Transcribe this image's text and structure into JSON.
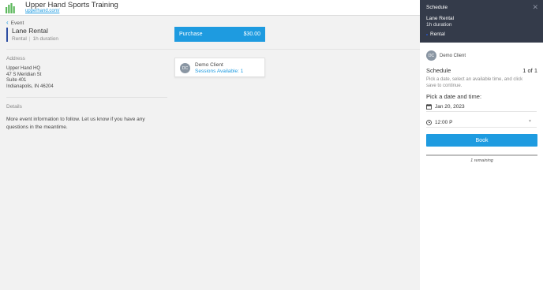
{
  "header": {
    "brand_name": "Upper Hand Sports Training",
    "brand_link": "upperhand.com/",
    "logo_icon": "bar-chart-hand-icon",
    "brand_color": "#5cb85c"
  },
  "event": {
    "back_label": "Event",
    "title": "Lane Rental",
    "type": "Rental",
    "duration": "1h duration",
    "accent_color": "#2d4ea2"
  },
  "address": {
    "label": "Address",
    "lines": [
      "Upper Hand HQ",
      "47 S Meridian St",
      "Suite 401",
      "Indianapolis, IN 46204"
    ]
  },
  "details": {
    "label": "Details",
    "text": "More event information to follow. Let us know if you have any questions in the meantime."
  },
  "purchase": {
    "label": "Purchase",
    "price": "$30.00",
    "color": "#1e9be0"
  },
  "client": {
    "initials": "DC",
    "name": "Demo Client",
    "sessions": "Sessions Available: 1"
  },
  "drawer": {
    "title": "Schedule",
    "close_icon": "close-icon",
    "event_name": "Lane Rental",
    "event_duration": "1h duration",
    "event_type": "Rental",
    "client_initials": "DC",
    "client_name": "Demo Client",
    "schedule_label": "Schedule",
    "count": "1 of 1",
    "help_text": "Pick a date, select an available time, and click save to continue.",
    "pick_label": "Pick a date and time:",
    "date_value": "Jan 20, 2023",
    "time_value": "12:00 P",
    "book_label": "Book",
    "remaining": "1 remaining",
    "header_bg": "#343b4a"
  }
}
